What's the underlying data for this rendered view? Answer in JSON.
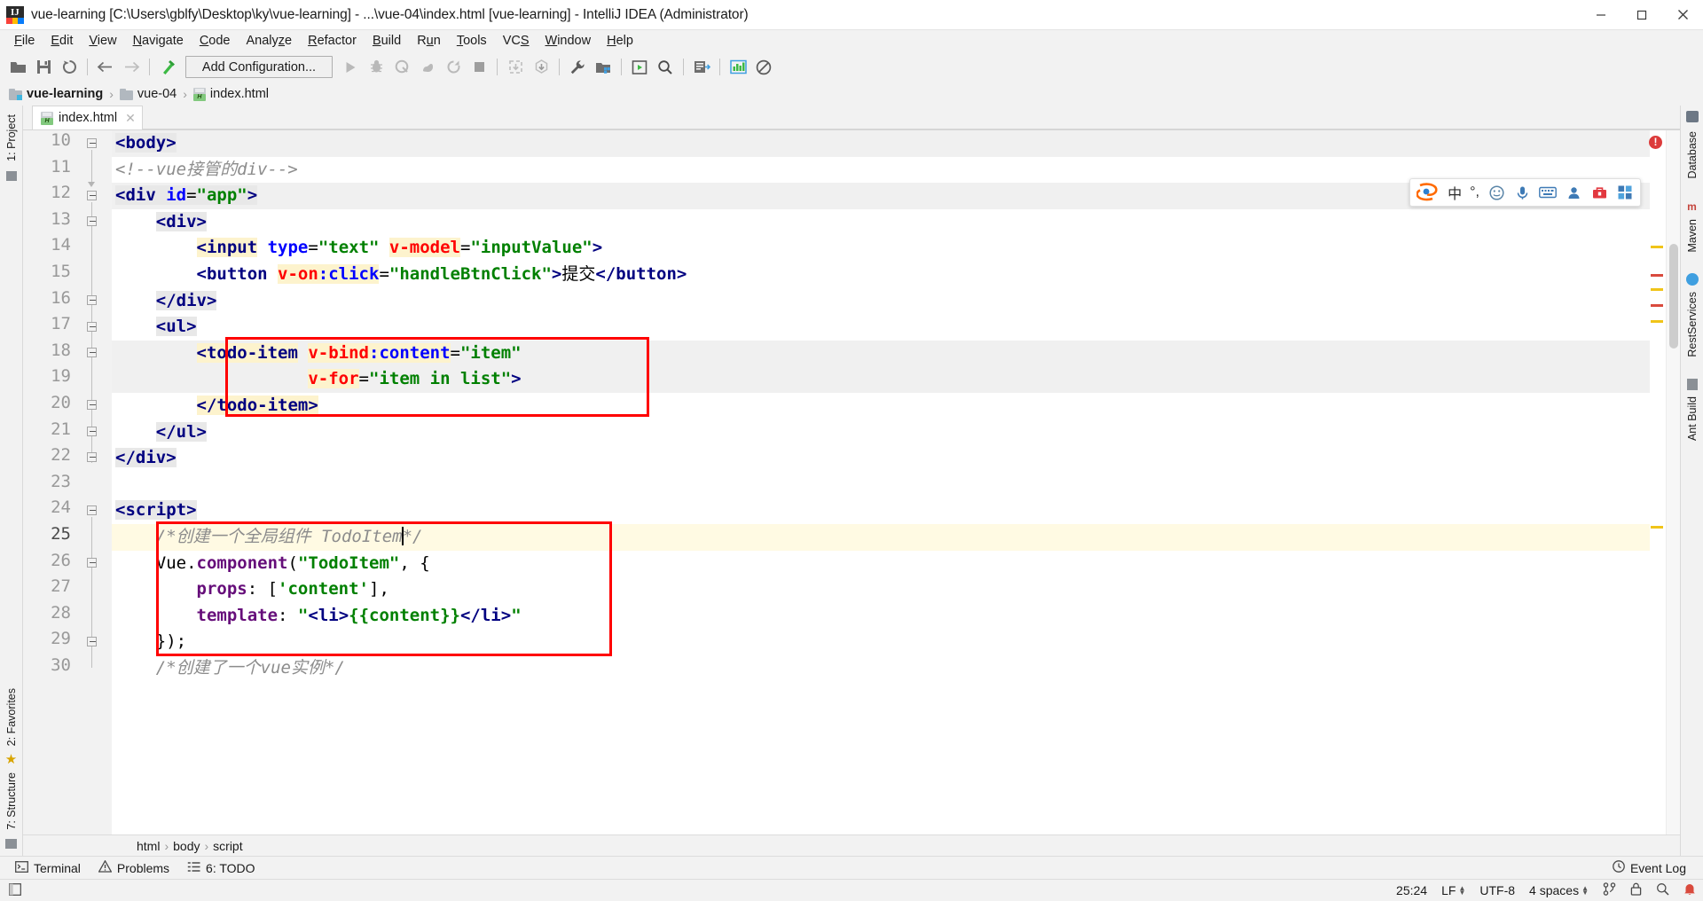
{
  "window": {
    "title": "vue-learning [C:\\Users\\gblfy\\Desktop\\ky\\vue-learning] - ...\\vue-04\\index.html [vue-learning] - IntelliJ IDEA (Administrator)",
    "app_icon": "intellij-idea-icon",
    "minimize_label": "—",
    "maximize_label": "❐",
    "close_label": "✕"
  },
  "menubar": {
    "items": [
      {
        "label": "File",
        "mnemonic": "F"
      },
      {
        "label": "Edit",
        "mnemonic": "E"
      },
      {
        "label": "View",
        "mnemonic": "V"
      },
      {
        "label": "Navigate",
        "mnemonic": "N"
      },
      {
        "label": "Code",
        "mnemonic": "C"
      },
      {
        "label": "Analyze",
        "mnemonic": "z"
      },
      {
        "label": "Refactor",
        "mnemonic": "R"
      },
      {
        "label": "Build",
        "mnemonic": "B"
      },
      {
        "label": "Run",
        "mnemonic": "u"
      },
      {
        "label": "Tools",
        "mnemonic": "T"
      },
      {
        "label": "VCS",
        "mnemonic": "S"
      },
      {
        "label": "Window",
        "mnemonic": "W"
      },
      {
        "label": "Help",
        "mnemonic": "H"
      }
    ]
  },
  "toolbar": {
    "run_config_label": "Add Configuration...",
    "icons": [
      "open-folder-icon",
      "save-all-icon",
      "sync-refresh-icon",
      "back-arrow-icon",
      "forward-arrow-icon",
      "build-hammer-icon",
      "run-icon",
      "debug-icon",
      "run-with-coverage-icon",
      "profile-icon",
      "rerun-icon",
      "stop-icon",
      "update-app-icon",
      "install-app-icon",
      "settings-wrench-icon",
      "project-structure-icon",
      "run-browser-icon",
      "search-everywhere-icon",
      "live-edit-icon",
      "diagram-icon",
      "no-entry-icon"
    ]
  },
  "breadcrumb": {
    "items": [
      {
        "label": "vue-learning",
        "icon": "project-folder-icon"
      },
      {
        "label": "vue-04",
        "icon": "folder-icon"
      },
      {
        "label": "index.html",
        "icon": "html-file-icon"
      }
    ],
    "separator": "›"
  },
  "editor": {
    "tab": {
      "label": "index.html",
      "icon": "html-file-icon",
      "close": "✕"
    },
    "first_line": 10,
    "caret_position": "25:24",
    "lines": [
      {
        "n": 10,
        "indent": 0,
        "highlight": "grey",
        "fold": "start"
      },
      {
        "n": 11,
        "indent": 0,
        "highlight": "none",
        "fold": "none"
      },
      {
        "n": 12,
        "indent": 0,
        "highlight": "grey",
        "fold": "start"
      },
      {
        "n": 13,
        "indent": 1,
        "highlight": "none",
        "fold": "start"
      },
      {
        "n": 14,
        "indent": 2,
        "highlight": "none",
        "fold": "none"
      },
      {
        "n": 15,
        "indent": 2,
        "highlight": "none",
        "fold": "none"
      },
      {
        "n": 16,
        "indent": 1,
        "highlight": "none",
        "fold": "end"
      },
      {
        "n": 17,
        "indent": 1,
        "highlight": "none",
        "fold": "start"
      },
      {
        "n": 18,
        "indent": 2,
        "highlight": "grey",
        "fold": "start"
      },
      {
        "n": 19,
        "indent": 2,
        "highlight": "grey",
        "fold": "none"
      },
      {
        "n": 20,
        "indent": 2,
        "highlight": "none",
        "fold": "end"
      },
      {
        "n": 21,
        "indent": 1,
        "highlight": "none",
        "fold": "end"
      },
      {
        "n": 22,
        "indent": 0,
        "highlight": "none",
        "fold": "end"
      },
      {
        "n": 23,
        "indent": 0,
        "highlight": "none",
        "fold": "none"
      },
      {
        "n": 24,
        "indent": 0,
        "highlight": "none",
        "fold": "start"
      },
      {
        "n": 25,
        "indent": 1,
        "highlight": "yellow",
        "fold": "none"
      },
      {
        "n": 26,
        "indent": 1,
        "highlight": "none",
        "fold": "start"
      },
      {
        "n": 27,
        "indent": 2,
        "highlight": "none",
        "fold": "none"
      },
      {
        "n": 28,
        "indent": 2,
        "highlight": "none",
        "fold": "none"
      },
      {
        "n": 29,
        "indent": 1,
        "highlight": "none",
        "fold": "end"
      },
      {
        "n": 30,
        "indent": 1,
        "highlight": "none",
        "fold": "none"
      }
    ],
    "source_text": [
      "<body>",
      "<!--vue接管的div-->",
      "<div id=\"app\">",
      "    <div>",
      "        <input type=\"text\" v-model=\"inputValue\">",
      "        <button v-on:click=\"handleBtnClick\">提交</button>",
      "    </div>",
      "    <ul>",
      "        <todo-item v-bind:content=\"item\"",
      "                   v-for=\"item in list\">",
      "        </todo-item>",
      "    </ul>",
      "</div>",
      "",
      "<script>",
      "    /*创建一个全局组件 TodoItem*/",
      "    Vue.component(\"TodoItem\", {",
      "        props: ['content'],",
      "        template: \"<li>{{content}}</li>\"",
      "    });",
      "    /*创建一个vue实例*/"
    ],
    "annotations": [
      {
        "name": "todo-item-highlight-box",
        "color": "#ff0000"
      },
      {
        "name": "vue-component-highlight-box",
        "color": "#ff0000"
      }
    ],
    "error_badge": "!"
  },
  "structure_path": {
    "items": [
      "html",
      "body",
      "script"
    ],
    "separator": "›"
  },
  "left_rail": {
    "items": [
      {
        "label": "1: Project",
        "name": "project-tool-window"
      },
      {
        "label": "2: Favorites",
        "name": "favorites-tool-window"
      },
      {
        "label": "7: Structure",
        "name": "structure-tool-window"
      }
    ]
  },
  "right_rail": {
    "items": [
      {
        "label": "Database",
        "name": "database-tool-window"
      },
      {
        "label": "Maven",
        "name": "maven-tool-window"
      },
      {
        "label": "RestServices",
        "name": "rest-services-tool-window"
      },
      {
        "label": "Ant Build",
        "name": "ant-build-tool-window"
      }
    ]
  },
  "tool_windows": {
    "items": [
      {
        "label": "Terminal",
        "icon": "terminal-icon"
      },
      {
        "label": "Problems",
        "icon": "warning-triangle-icon"
      },
      {
        "label": "6: TODO",
        "icon": "todo-list-icon"
      }
    ],
    "event_log": {
      "label": "Event Log",
      "icon": "event-log-icon"
    }
  },
  "statusbar": {
    "caret": "25:24",
    "line_separator": "LF",
    "encoding": "UTF-8",
    "indent": "4 spaces",
    "icons": [
      "git-branch-icon",
      "lock-icon",
      "inspection-icon",
      "notification-bell-icon"
    ]
  },
  "ime": {
    "mode_label": "中",
    "punct_label": "°,",
    "icons": [
      "sogou-logo-icon",
      "emoji-icon",
      "microphone-icon",
      "keyboard-icon",
      "user-icon",
      "toolbox-icon",
      "grid-menu-icon"
    ]
  },
  "colors": {
    "tag": "#000080",
    "attribute": "#0000ff",
    "string": "#008000",
    "comment": "#8c8c8c",
    "directive": "#ff0000",
    "property": "#660e7a",
    "annotation_box": "#ff0000",
    "current_line": "#fffae3",
    "selection_match": "#fdf3cd"
  }
}
